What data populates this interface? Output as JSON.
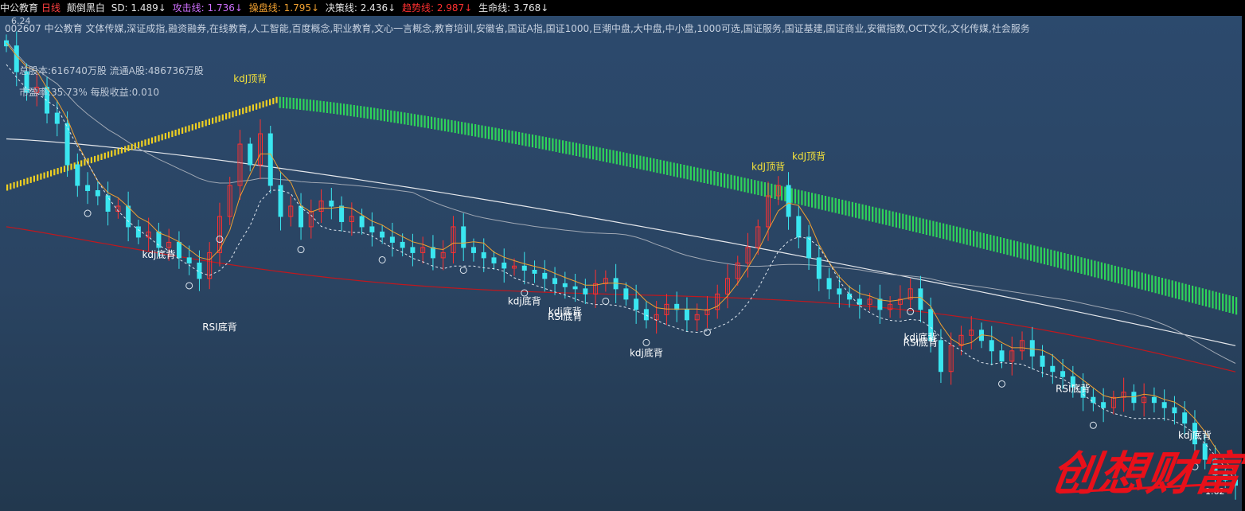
{
  "header": {
    "stock_name": "中公教育",
    "period": "日线",
    "indicator_name": "颠倒黑白",
    "sd": "SD: 1.489↓",
    "attack": "攻击线: 1.736↓",
    "operate": "操盘线: 1.795↓",
    "decision": "决策线: 2.436↓",
    "trend": "趋势线: 2.987↓",
    "life": "生命线: 3.768↓"
  },
  "info_line": "002607 中公教育 文体传媒,深证成指,融资融券,在线教育,人工智能,百度概念,职业教育,文心一言概念,教育培训,安徽省,国证A指,国证1000,巨潮中盘,大中盘,中小盘,1000可选,国证服务,国证基建,国证商业,安徽指数,OCT文化,文化传媒,社会服务",
  "stats": {
    "total_shares": "总股本:616740万股 流通A股:486736万股",
    "pe": "市盈率:35.73% 每股收益:0.010"
  },
  "price_labels": {
    "high": "6.24",
    "low": "1.62"
  },
  "watermark": "创想财富",
  "colors": {
    "up": "#ff3030",
    "down": "#3ae6f0",
    "green_band": "#2fd35a",
    "yellow_band": "#f0d020",
    "white_ma": "#e6e8ec",
    "red_ma": "#c0181e",
    "grey_ma": "#a0a8b4"
  },
  "chart_data": {
    "type": "candlestick",
    "ylim": [
      1.62,
      6.24
    ],
    "annotations": [
      {
        "text": "kdJ顶背",
        "x": 24,
        "y": 5.6
      },
      {
        "text": "kdj底背",
        "x": 15,
        "y": 3.9
      },
      {
        "text": "RSI底背",
        "x": 21,
        "y": 3.2
      },
      {
        "text": "kdJ顶背",
        "x": 75,
        "y": 4.75
      },
      {
        "text": "kdJ顶背",
        "x": 79,
        "y": 4.85
      },
      {
        "text": "kdj底背",
        "x": 51,
        "y": 3.45
      },
      {
        "text": "kdj底背",
        "x": 55,
        "y": 3.35
      },
      {
        "text": "RSI底背",
        "x": 55,
        "y": 3.3
      },
      {
        "text": "kdj底背",
        "x": 63,
        "y": 2.95
      },
      {
        "text": "kdj底背",
        "x": 90,
        "y": 3.1
      },
      {
        "text": "RSI底背",
        "x": 90,
        "y": 3.05
      },
      {
        "text": "RSI底背",
        "x": 105,
        "y": 2.6
      },
      {
        "text": "kdj底背",
        "x": 117,
        "y": 2.15
      }
    ],
    "closes": [
      5.95,
      5.7,
      5.5,
      5.55,
      5.3,
      5.2,
      4.8,
      4.6,
      4.55,
      4.5,
      4.35,
      4.4,
      4.2,
      4.1,
      4.15,
      4.0,
      4.05,
      3.9,
      3.85,
      3.7,
      3.95,
      4.3,
      4.6,
      5.0,
      4.8,
      5.1,
      4.6,
      4.3,
      4.4,
      4.2,
      4.35,
      4.45,
      4.4,
      4.25,
      4.3,
      4.2,
      4.15,
      4.1,
      4.05,
      4.0,
      3.95,
      4.0,
      3.9,
      3.95,
      4.2,
      4.0,
      3.95,
      3.9,
      3.85,
      3.8,
      3.82,
      3.78,
      3.75,
      3.7,
      3.65,
      3.62,
      3.6,
      3.55,
      3.65,
      3.7,
      3.6,
      3.5,
      3.4,
      3.3,
      3.35,
      3.45,
      3.4,
      3.3,
      3.35,
      3.4,
      3.55,
      3.7,
      3.85,
      4.0,
      4.2,
      4.5,
      4.6,
      4.3,
      4.1,
      3.9,
      3.7,
      3.6,
      3.55,
      3.5,
      3.45,
      3.5,
      3.4,
      3.45,
      3.5,
      3.6,
      3.4,
      3.1,
      2.8,
      3.05,
      3.15,
      3.2,
      3.1,
      3.0,
      2.9,
      3.0,
      3.1,
      2.95,
      2.85,
      2.8,
      2.75,
      2.65,
      2.55,
      2.5,
      2.45,
      2.55,
      2.6,
      2.5,
      2.55,
      2.5,
      2.45,
      2.4,
      2.3,
      2.1,
      1.95,
      1.8,
      1.75,
      1.7
    ]
  }
}
